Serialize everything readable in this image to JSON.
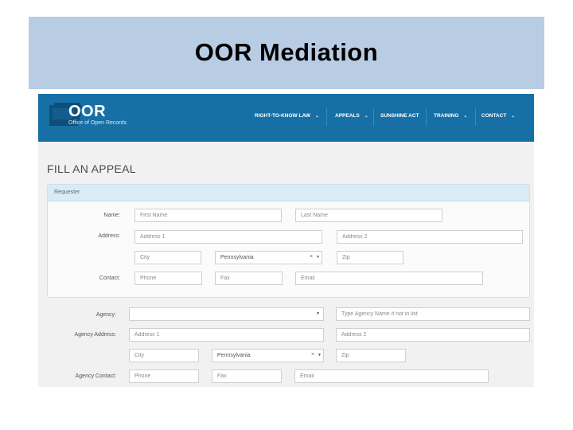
{
  "slide": {
    "title": "OOR Mediation"
  },
  "site": {
    "logo_name": "OOR",
    "logo_subtitle": "Office of Open Records",
    "nav": [
      {
        "label": "RIGHT-TO-KNOW LAW",
        "dropdown": true
      },
      {
        "label": "APPEALS",
        "dropdown": true
      },
      {
        "label": "SUNSHINE ACT",
        "dropdown": false
      },
      {
        "label": "TRAINING",
        "dropdown": true
      },
      {
        "label": "CONTACT",
        "dropdown": true
      }
    ],
    "nav_color": "#1670a6"
  },
  "form": {
    "heading": "FILL AN APPEAL",
    "requester": {
      "section_label": "Requester",
      "name_label": "Name:",
      "first_name_placeholder": "First Name",
      "last_name_placeholder": "Last Name",
      "address_label": "Address:",
      "address1_placeholder": "Address 1",
      "address2_placeholder": "Address 2",
      "city_placeholder": "City",
      "state_value": "Pennsylvania",
      "zip_placeholder": "Zip",
      "contact_label": "Contact:",
      "phone_placeholder": "Phone",
      "fax_placeholder": "Fax",
      "email_placeholder": "Email"
    },
    "agency": {
      "agency_label": "Agency:",
      "agency_value": "",
      "agency_name_placeholder": "Type Agency Name if not in list",
      "address_label": "Agency Address:",
      "address1_placeholder": "Address 1",
      "address2_placeholder": "Address 2",
      "city_placeholder": "City",
      "state_value": "Pennsylvania",
      "zip_placeholder": "Zip",
      "contact_label": "Agency Contact:",
      "phone_placeholder": "Phone",
      "fax_placeholder": "Fax",
      "email_placeholder": "Email"
    }
  },
  "icons": {
    "clear": "×",
    "caret": "▼",
    "chevron": "⌄"
  }
}
